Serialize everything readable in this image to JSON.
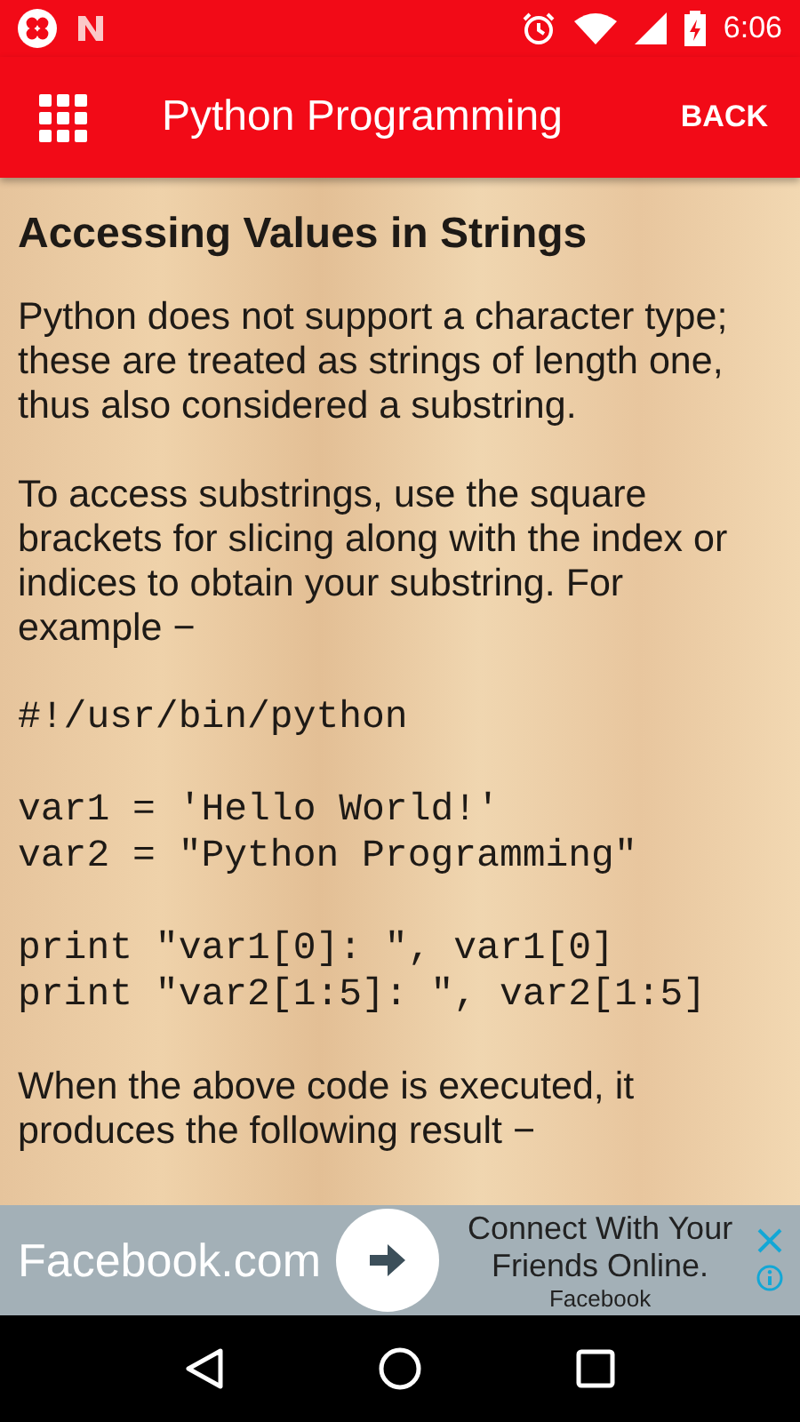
{
  "status_bar": {
    "time": "6:06"
  },
  "app_bar": {
    "title": "Python Programming",
    "action": "BACK"
  },
  "content": [
    {
      "kind": "heading",
      "text": "Accessing Values in Strings"
    },
    {
      "kind": "paragraph",
      "text": "Python does not support a character type; these are treated as strings of length one, thus also considered a substring."
    },
    {
      "kind": "paragraph",
      "text": "To access substrings, use the square brackets for slicing along with the index or indices to obtain your substring. For example −"
    },
    {
      "kind": "code",
      "lines": [
        "#!/usr/bin/python"
      ]
    },
    {
      "kind": "code",
      "lines": [
        "var1 = 'Hello World!'",
        "var2 = \"Python Programming\""
      ]
    },
    {
      "kind": "code",
      "lines": [
        "print \"var1[0]: \", var1[0]",
        "print \"var2[1:5]: \", var2[1:5]"
      ]
    },
    {
      "kind": "paragraph",
      "text": "When the above code is executed, it produces the following result −"
    }
  ],
  "ad": {
    "headline": "Facebook.com",
    "text": "Connect With Your Friends Online.",
    "advertiser": "Facebook"
  }
}
